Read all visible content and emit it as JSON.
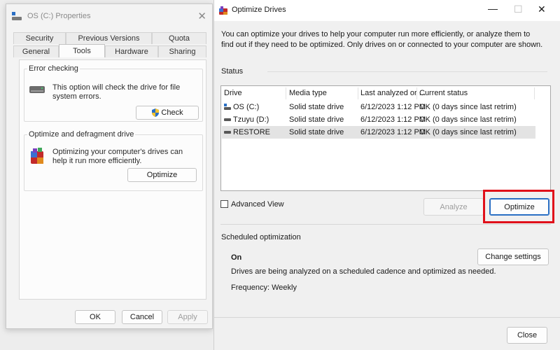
{
  "properties_window": {
    "title": "OS (C:) Properties",
    "tabs_row1": [
      "Security",
      "Previous Versions",
      "Quota"
    ],
    "tabs_row2": [
      "General",
      "Tools",
      "Hardware",
      "Sharing"
    ],
    "error_checking": {
      "title": "Error checking",
      "text": "This option will check the drive for file system errors.",
      "button": "Check"
    },
    "optimize": {
      "title": "Optimize and defragment drive",
      "text": "Optimizing your computer's drives can help it run more efficiently.",
      "button": "Optimize"
    },
    "buttons": {
      "ok": "OK",
      "cancel": "Cancel",
      "apply": "Apply"
    }
  },
  "optimize_drives": {
    "title": "Optimize Drives",
    "description": "You can optimize your drives to help your computer run more efficiently, or analyze them to find out if they need to be optimized. Only drives on or connected to your computer are shown.",
    "status_label": "Status",
    "columns": [
      "Drive",
      "Media type",
      "Last analyzed or ...",
      "Current status"
    ],
    "drives": [
      {
        "drive": "OS (C:)",
        "media": "Solid state drive",
        "last": "6/12/2023 1:12 PM",
        "status": "OK (0 days since last retrim)",
        "icon": "os-drive-icon"
      },
      {
        "drive": "Tzuyu (D:)",
        "media": "Solid state drive",
        "last": "6/12/2023 1:12 PM",
        "status": "OK (0 days since last retrim)",
        "icon": "drive-icon"
      },
      {
        "drive": "RESTORE",
        "media": "Solid state drive",
        "last": "6/12/2023 1:12 PM",
        "status": "OK (0 days since last retrim)",
        "icon": "drive-icon"
      }
    ],
    "selected_row": 2,
    "advanced_view": {
      "label": "Advanced View",
      "checked": false
    },
    "analyze_button": "Analyze",
    "optimize_button": "Optimize",
    "scheduled": {
      "label": "Scheduled optimization",
      "state": "On",
      "text": "Drives are being analyzed on a scheduled cadence and optimized as needed.",
      "frequency": "Frequency: Weekly",
      "change_button": "Change settings"
    },
    "close_button": "Close"
  },
  "colors": {
    "highlight": "#e0101a",
    "accent": "#2a6fc4"
  }
}
